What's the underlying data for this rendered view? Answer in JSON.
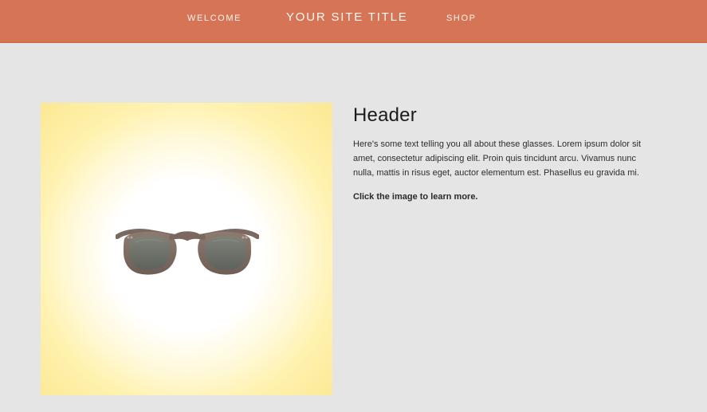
{
  "header": {
    "nav": {
      "welcome": "Welcome",
      "site_title": "Your Site Title",
      "shop": "Shop"
    }
  },
  "product": {
    "image_icon": "sunglasses-icon",
    "title": "Header",
    "description": "Here's some text telling you all about these glasses. Lorem ipsum dolor sit amet, consectetur adipiscing elit. Proin quis tincidunt arcu. Vivamus nunc nulla, mattis in risus eget, auctor elementum est. Phasellus eu gravida mi.",
    "cta": "Click the image to learn more."
  },
  "colors": {
    "header_background": "#d57556",
    "page_background": "#e5e5e5",
    "image_glow": "#fbe892"
  }
}
